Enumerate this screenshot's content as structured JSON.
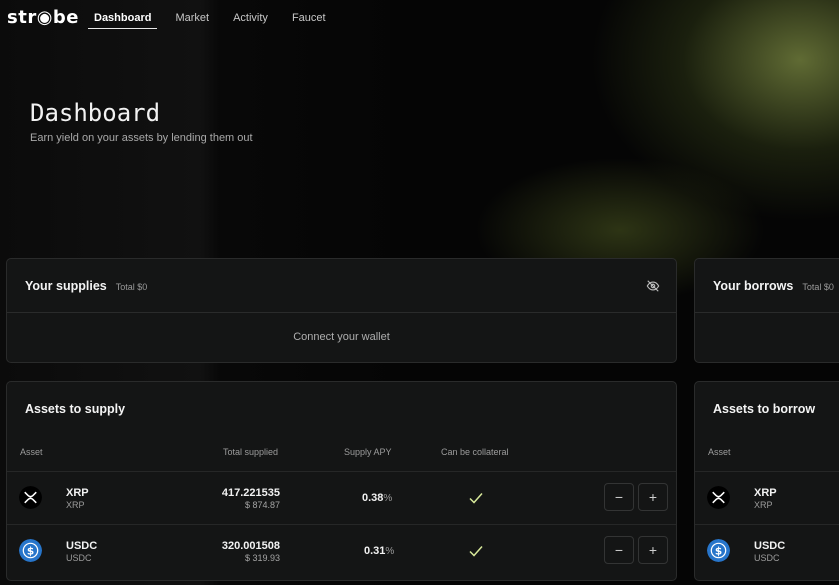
{
  "app": {
    "logo": "str◉be"
  },
  "nav": {
    "items": [
      {
        "label": "Dashboard",
        "active": true
      },
      {
        "label": "Market",
        "active": false
      },
      {
        "label": "Activity",
        "active": false
      },
      {
        "label": "Faucet",
        "active": false
      }
    ]
  },
  "hero": {
    "title": "Dashboard",
    "subtitle": "Earn yield on your assets by lending them out"
  },
  "supplies": {
    "title": "Your supplies",
    "total": "Total $0",
    "connect": "Connect your wallet",
    "visibility_icon": "eye-off-icon"
  },
  "borrows": {
    "title": "Your borrows",
    "total": "Total $0"
  },
  "assets_supply": {
    "title": "Assets to supply",
    "columns": {
      "asset": "Asset",
      "total_supplied": "Total supplied",
      "supply_apy": "Supply APY",
      "collateral": "Can be collateral"
    },
    "rows": [
      {
        "symbol": "XRP",
        "name": "XRP",
        "amount": "417.221535",
        "usd": "$ 874.87",
        "apy": "0.38",
        "apy_unit": "%",
        "collateral": true,
        "icon": "xrp-icon"
      },
      {
        "symbol": "USDC",
        "name": "USDC",
        "amount": "320.001508",
        "usd": "$ 319.93",
        "apy": "0.31",
        "apy_unit": "%",
        "collateral": true,
        "icon": "usdc-icon"
      }
    ],
    "decrease_label": "−",
    "increase_label": "+"
  },
  "assets_borrow": {
    "title": "Assets to borrow",
    "columns": {
      "asset": "Asset"
    },
    "rows": [
      {
        "symbol": "XRP",
        "name": "XRP",
        "icon": "xrp-icon"
      },
      {
        "symbol": "USDC",
        "name": "USDC",
        "icon": "usdc-icon"
      }
    ]
  },
  "colors": {
    "background": "#050505",
    "card": "#141515",
    "border": "#2a2b2b",
    "check": "#d7e89a",
    "usdc": "#2775ca"
  }
}
